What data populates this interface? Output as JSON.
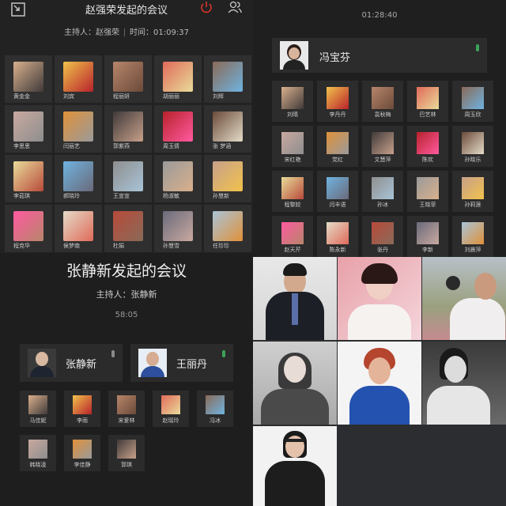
{
  "meeting1": {
    "title": "赵强荣发起的会议",
    "host_label": "主持人：赵强荣",
    "time_label": "时间：01:09:37",
    "participants": [
      "黄金金",
      "刘宾",
      "程丽妍",
      "胡丽丽",
      "刘辉",
      "李思思",
      "闫丽艺",
      "郭紫燕",
      "周玉倩",
      "张 梦涵",
      "李茹琪",
      "郝晓玲",
      "王宣宣",
      "杨淑敏",
      "孙慧新",
      "程克华",
      "侯梦南",
      "杜娟",
      "孙慧雪",
      "任珍珍"
    ]
  },
  "meeting2": {
    "time": "01:28:40",
    "host_name": "冯宝芬",
    "participants": [
      "刘晴",
      "李丹丹",
      "袁秋梅",
      "巴艺林",
      "周玉欣",
      "宋红艳",
      "党红",
      "文慧萍",
      "陈欢",
      "孙晓乐",
      "程黎姣",
      "闫丰语",
      "孙冰",
      "王晓菲",
      "孙莉莲",
      "赵天芹",
      "陈永新",
      "张丹",
      "李新",
      "刘晨萍"
    ]
  },
  "meeting3": {
    "title": "张静新发起的会议",
    "host_label": "主持人：张静新",
    "time": "58:05",
    "hosts": [
      {
        "name": "张静新"
      },
      {
        "name": "王丽丹"
      }
    ],
    "participants": [
      "马佳妮",
      "李雨",
      "宋爱林",
      "赵瑶玲",
      "冯冰",
      "韩晓凌",
      "李佳静",
      "郭琪"
    ]
  },
  "colors": {
    "mic_active": "#3ca35a",
    "mic_muted": "#8a8a8a",
    "accent_red": "#d9342b"
  },
  "icons": {
    "top_left": "exit-fullscreen-icon",
    "power": "power-icon",
    "members": "members-icon"
  }
}
